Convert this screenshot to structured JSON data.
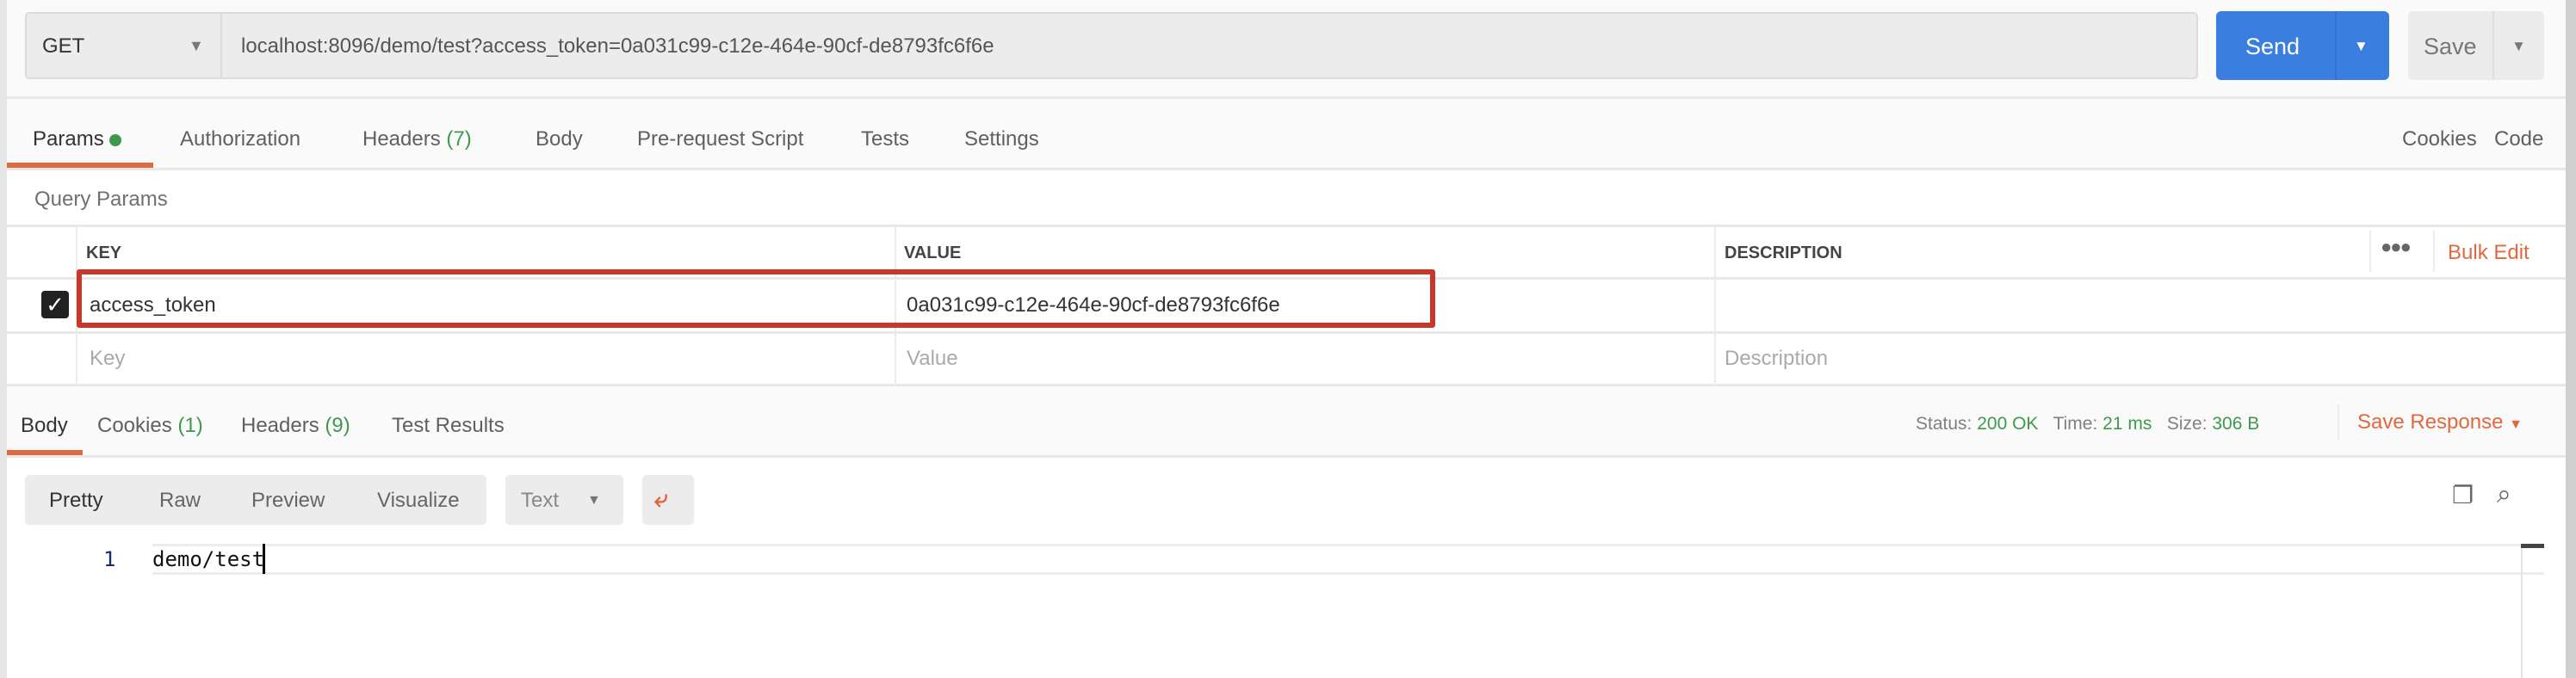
{
  "request": {
    "method": "GET",
    "url": "localhost:8096/demo/test?access_token=0a031c99-c12e-464e-90cf-de8793fc6f6e",
    "send_label": "Send",
    "save_label": "Save"
  },
  "request_tabs": [
    {
      "label": "Params",
      "active": true,
      "indicator": "green-dot"
    },
    {
      "label": "Authorization"
    },
    {
      "label": "Headers",
      "count": "(7)"
    },
    {
      "label": "Body"
    },
    {
      "label": "Pre-request Script"
    },
    {
      "label": "Tests"
    },
    {
      "label": "Settings"
    }
  ],
  "request_links": {
    "cookies": "Cookies",
    "code": "Code"
  },
  "query_params": {
    "title": "Query Params",
    "columns": {
      "key": "KEY",
      "value": "VALUE",
      "description": "DESCRIPTION"
    },
    "bulk_edit": "Bulk Edit",
    "rows": [
      {
        "checked": true,
        "key": "access_token",
        "value": "0a031c99-c12e-464e-90cf-de8793fc6f6e",
        "description": ""
      }
    ],
    "placeholders": {
      "key": "Key",
      "value": "Value",
      "description": "Description"
    }
  },
  "response_tabs": [
    {
      "label": "Body",
      "active": true
    },
    {
      "label": "Cookies",
      "count": "(1)"
    },
    {
      "label": "Headers",
      "count": "(9)"
    },
    {
      "label": "Test Results"
    }
  ],
  "response_meta": {
    "status_label": "Status:",
    "status": "200 OK",
    "time_label": "Time:",
    "time": "21 ms",
    "size_label": "Size:",
    "size": "306 B",
    "save_response": "Save Response"
  },
  "view_modes": [
    "Pretty",
    "Raw",
    "Preview",
    "Visualize"
  ],
  "format": "Text",
  "body_lines": [
    {
      "number": "1",
      "text": "demo/test"
    }
  ],
  "colors": {
    "accent": "#e0693f",
    "send": "#3a7fe0",
    "success": "#3d9a4c",
    "highlight_box": "#c8372a"
  }
}
